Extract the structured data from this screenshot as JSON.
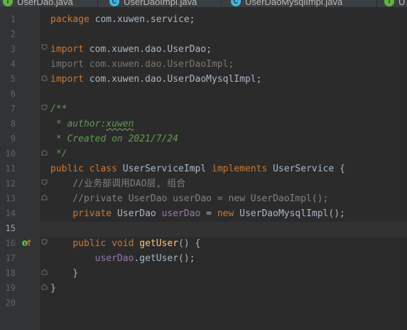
{
  "tabs": [
    {
      "label": "UserDao.java",
      "icon": "interface-icon"
    },
    {
      "label": "UserDaoImpl.java",
      "icon": "class-icon"
    },
    {
      "label": "UserDaoMysqlImpl.java",
      "icon": "class-icon"
    },
    {
      "label": "U",
      "icon": "interface-icon"
    }
  ],
  "line_numbers": [
    "1",
    "2",
    "3",
    "4",
    "5",
    "6",
    "7",
    "8",
    "9",
    "10",
    "11",
    "12",
    "13",
    "14",
    "15",
    "16",
    "17",
    "18",
    "19",
    "20"
  ],
  "code": {
    "l1_kw": "package",
    "l1_rest": " com.xuwen.service;",
    "l3_kw": "import",
    "l3_rest": " com.xuwen.dao.UserDao;",
    "l4": "import com.xuwen.dao.UserDaoImpl;",
    "l5_kw": "import",
    "l5_rest": " com.xuwen.dao.UserDaoMysqlImpl;",
    "l7": "/**",
    "l8_pre": " * ",
    "l8_tag": "author:",
    "l8_name": "xuwen",
    "l9": " * Created on 2021/7/24",
    "l10": " */",
    "l11_kw1": "public",
    "l11_kw2": "class",
    "l11_name": "UserServiceImpl",
    "l11_kw3": "implements",
    "l11_rest": "UserService {",
    "l12": "    //业务部调用DAO层, 组合",
    "l13": "    //private UserDao userDao = new UserDaoImpl();",
    "l14_kw": "private",
    "l14_type": "UserDao",
    "l14_field": "userDao",
    "l14_eq": " = ",
    "l14_new": "new",
    "l14_rest": " UserDaoMysqlImpl();",
    "l16_kw1": "public",
    "l16_kw2": "void",
    "l16_fn": "getUser",
    "l16_rest": "() {",
    "l17_field": "userDao",
    "l17_rest": ".getUser();",
    "l18": "    }",
    "l19": "}"
  },
  "colors": {
    "background": "#2b2b2b",
    "gutter": "#313335",
    "keyword": "#cc7832",
    "comment": "#808080",
    "doc_comment": "#629755",
    "field": "#9876aa",
    "method": "#ffc66d",
    "text": "#a9b7c6"
  }
}
